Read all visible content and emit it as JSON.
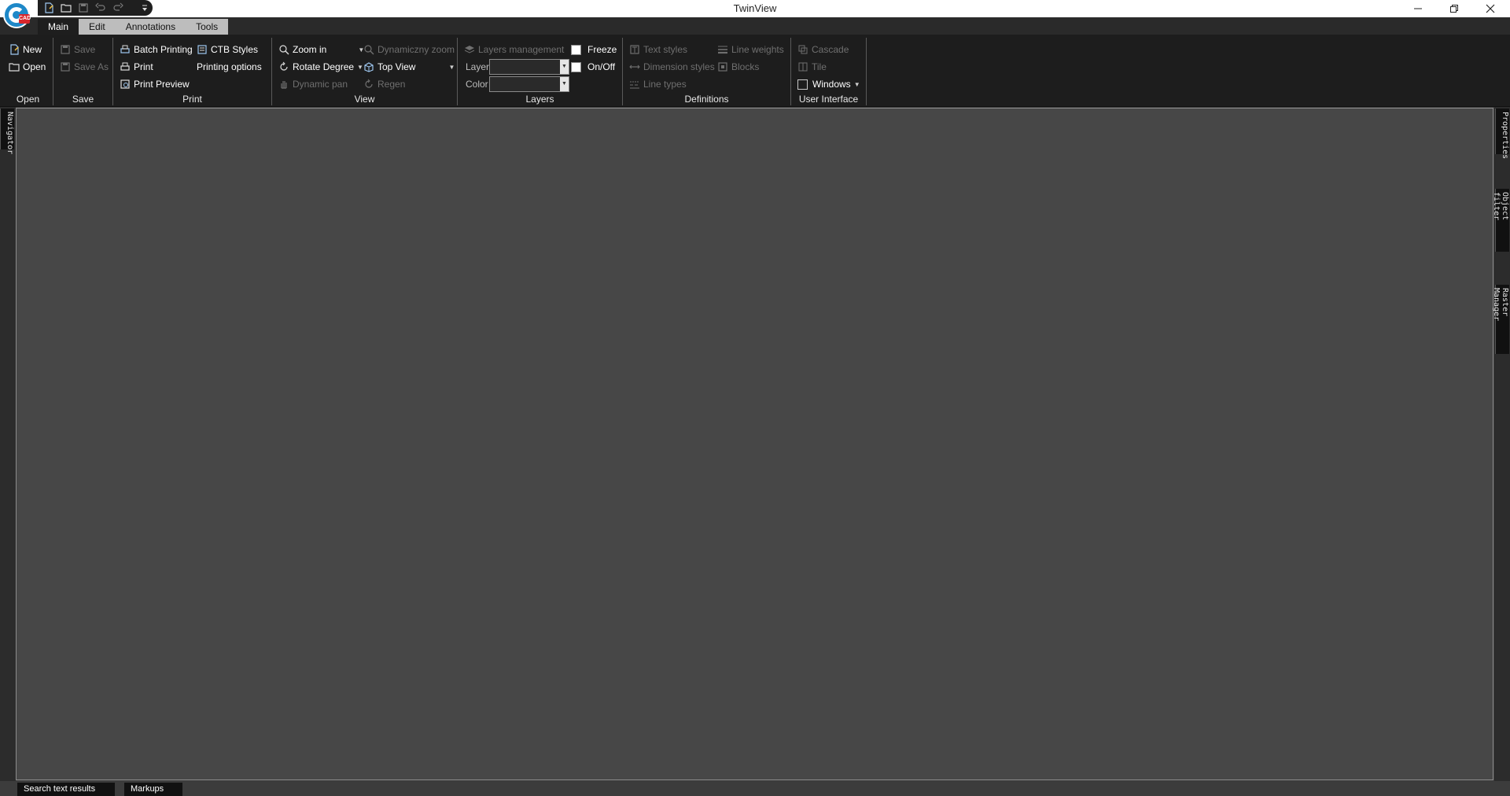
{
  "window": {
    "title": "TwinView",
    "logo_badge": "CAD"
  },
  "quick_access": {
    "icons": [
      "new-file-icon",
      "open-folder-icon",
      "save-icon",
      "undo-icon",
      "redo-icon",
      "customize-arrow-icon"
    ]
  },
  "tabs": [
    "Main",
    "Edit",
    "Annotations",
    "Tools"
  ],
  "active_tab": "Main",
  "ribbon": {
    "open": {
      "title": "Open",
      "new": "New",
      "open": "Open"
    },
    "save": {
      "title": "Save",
      "save": "Save",
      "save_as": "Save As"
    },
    "print": {
      "title": "Print",
      "batch_printing": "Batch Printing",
      "ctb_styles": "CTB Styles",
      "print": "Print",
      "printing_options": "Printing options",
      "print_preview": "Print Preview"
    },
    "view": {
      "title": "View",
      "zoom_in": "Zoom in",
      "dynamic_zoom": "Dynamiczny zoom",
      "rotate_degree": "Rotate Degree",
      "top_view": "Top View",
      "dynamic_pan": "Dynamic pan",
      "regen": "Regen"
    },
    "layers": {
      "title": "Layers",
      "layers_management": "Layers management",
      "freeze": "Freeze",
      "layer_label": "Layer",
      "on_off": "On/Off",
      "color_label": "Color",
      "layer_value": "",
      "color_value": ""
    },
    "definitions": {
      "title": "Definitions",
      "text_styles": "Text styles",
      "line_weights": "Line weights",
      "dimension_styles": "Dimension styles",
      "blocks": "Blocks",
      "line_types": "Line types"
    },
    "user_interface": {
      "title": "User Interface",
      "cascade": "Cascade",
      "tile": "Tile",
      "windows": "Windows"
    }
  },
  "side_panels": {
    "left": [
      "Navigator"
    ],
    "right": [
      "Properties",
      "Object filter",
      "Raster Manager"
    ]
  },
  "bottom_tabs": [
    "Search text results",
    "Markups"
  ],
  "colors": {
    "ribbon_bg": "#1d1d1d",
    "workspace_bg": "#474747",
    "tab_inactive": "#bdbdbd",
    "disabled_text": "#6f6f6f"
  }
}
